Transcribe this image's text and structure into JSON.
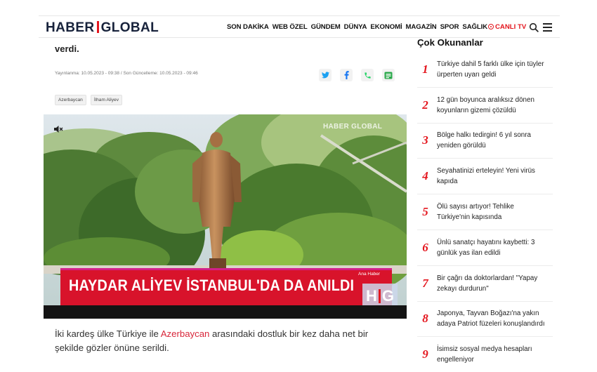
{
  "header": {
    "logo_left": "HABER",
    "logo_right": "GLOBAL",
    "nav": [
      "SON DAKİKA",
      "WEB ÖZEL",
      "GÜNDEM",
      "DÜNYA",
      "EKONOMİ",
      "MAGAZİN",
      "SPOR",
      "SAĞLIK"
    ],
    "live_label": "CANLI TV"
  },
  "article": {
    "lead_tail": "verdi.",
    "dates": "Yayınlanma: 10.05.2023 - 09:38 / Son Güncelleme: 10.05.2023 - 09:46",
    "tags": [
      "Azerbaycan",
      "İlham Aliyev"
    ],
    "video": {
      "watermark": "HABER GLOBAL",
      "headline": "HAYDAR ALİYEV İSTANBUL'DA DA ANILDI",
      "hg_label": "Ana Haber",
      "hg_logo_left": "H",
      "hg_logo_right": "G"
    },
    "body_before": "İki kardeş ülke Türkiye ile ",
    "body_link": "Azerbaycan",
    "body_after": " arasındaki dostluk bir kez daha net bir şekilde gözler önüne serildi."
  },
  "sidebar": {
    "title": "Çok Okunanlar",
    "items": [
      {
        "num": "1",
        "text": "Türkiye dahil 5 farklı ülke için tüyler ürperten uyarı geldi"
      },
      {
        "num": "2",
        "text": "12 gün boyunca aralıksız dönen koyunların gizemi çözüldü"
      },
      {
        "num": "3",
        "text": "Bölge halkı tedirgin! 6 yıl sonra yeniden görüldü"
      },
      {
        "num": "4",
        "text": "Seyahatinizi erteleyin! Yeni virüs kapıda"
      },
      {
        "num": "5",
        "text": "Ölü sayısı artıyor! Tehlike Türkiye'nin kapısında"
      },
      {
        "num": "6",
        "text": "Ünlü sanatçı hayatını kaybetti: 3 günlük yas ilan edildi"
      },
      {
        "num": "7",
        "text": "Bir çağrı da doktorlardan! \"Yapay zekayı durdurun\""
      },
      {
        "num": "8",
        "text": "Japonya, Tayvan Boğazı'na yakın adaya Patriot füzeleri konuşlandırdı"
      },
      {
        "num": "9",
        "text": "İsimsiz sosyal medya hesapları engelleniyor"
      }
    ]
  },
  "colors": {
    "brand_red": "#e4161e",
    "brand_navy": "#17223b",
    "link_red": "#d8263a",
    "twitter": "#1da1f2",
    "facebook": "#1877f2",
    "whatsapp": "#25d366",
    "news": "#2aa84a"
  },
  "icons": [
    "live-dot-icon",
    "search-icon",
    "menu-icon",
    "twitter-icon",
    "facebook-icon",
    "whatsapp-icon",
    "google-news-icon",
    "mute-icon"
  ]
}
